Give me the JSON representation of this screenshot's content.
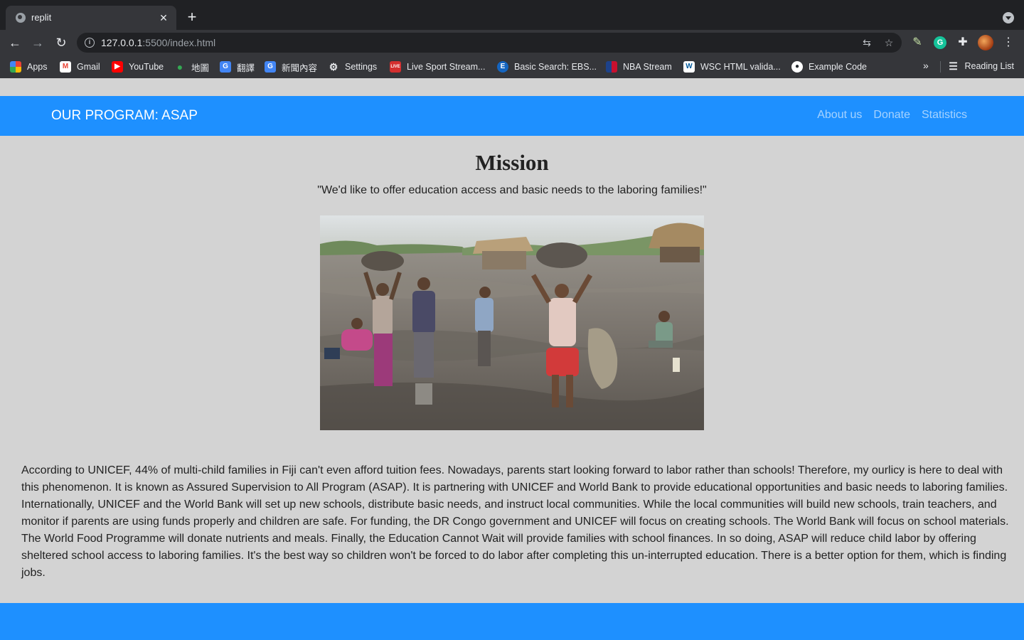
{
  "browser": {
    "tab_title": "replit",
    "url_host": "127.0.0.1",
    "url_path": ":5500/index.html",
    "bookmarks": [
      {
        "label": "Apps",
        "icon": "apps-grid-icon"
      },
      {
        "label": "Gmail",
        "icon": "gmail-icon"
      },
      {
        "label": "YouTube",
        "icon": "youtube-icon"
      },
      {
        "label": "地圖",
        "icon": "maps-icon"
      },
      {
        "label": "翻譯",
        "icon": "translate-icon"
      },
      {
        "label": "新聞內容",
        "icon": "news-icon"
      },
      {
        "label": "Settings",
        "icon": "gear-icon"
      },
      {
        "label": "Live Sport Stream...",
        "icon": "live-icon"
      },
      {
        "label": "Basic Search: EBS...",
        "icon": "ebsco-icon"
      },
      {
        "label": "NBA Stream",
        "icon": "nba-icon"
      },
      {
        "label": "WSC HTML valida...",
        "icon": "w3c-icon"
      },
      {
        "label": "Example Code",
        "icon": "github-icon"
      }
    ],
    "reading_list": "Reading List"
  },
  "navbar": {
    "brand": "OUR PROGRAM: ASAP",
    "links": [
      "About us",
      "Donate",
      "Statistics"
    ]
  },
  "mission": {
    "title": "Mission",
    "quote": "\"We'd like to offer education access and basic needs to the laboring families!\""
  },
  "body": {
    "text": "According to UNICEF, 44% of multi-child families in Fiji can't even afford tuition fees. Nowadays, parents start looking forward to labor rather than schools! Therefore, my ourlicy is here to deal with this phenomenon. It is known as Assured Supervision to All Program (ASAP). It is partnering with UNICEF and World Bank to provide educational opportunities and basic needs to laboring families. Internationally, UNICEF and the World Bank will set up new schools, distribute basic needs, and instruct local communities. While the local communities will build new schools, train teachers, and monitor if parents are using funds properly and children are safe. For funding, the DR Congo government and UNICEF will focus on creating schools. The World Bank will focus on school materials. The World Food Programme will donate nutrients and meals. Finally, the Education Cannot Wait will provide families with school finances. In so doing, ASAP will reduce child labor by offering sheltered school access to laboring families. It's the best way so children won't be forced to do labor after completing this un-interrupted education. There is a better option for them, which is finding jobs."
  },
  "colors": {
    "navbar": "#1e90ff",
    "page_bg": "#d3d3d3"
  }
}
